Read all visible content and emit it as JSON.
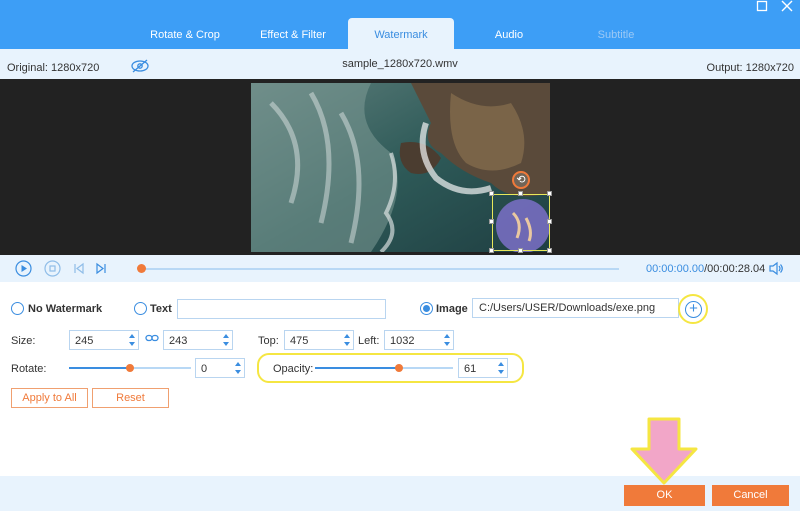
{
  "tabs": [
    {
      "label": "Rotate & Crop"
    },
    {
      "label": "Effect & Filter"
    },
    {
      "label": "Watermark"
    },
    {
      "label": "Audio"
    },
    {
      "label": "Subtitle"
    }
  ],
  "window": {
    "maximize_icon": "maximize-icon",
    "close_icon": "close-icon"
  },
  "info": {
    "original": "Original: 1280x720",
    "filename": "sample_1280x720.wmv",
    "output": "Output: 1280x720"
  },
  "playback": {
    "current_time": "00:00:00.00",
    "total_time": "/00:00:28.04"
  },
  "watermark": {
    "no_watermark_label": "No Watermark",
    "text_label": "Text",
    "text_value": "",
    "image_label": "Image",
    "image_path": "C:/Users/USER/Downloads/exe.png",
    "selected": "image"
  },
  "size": {
    "label": "Size:",
    "width": "245",
    "height": "243"
  },
  "position": {
    "top_label": "Top:",
    "top": "475",
    "left_label": "Left:",
    "left": "1032"
  },
  "rotate": {
    "label": "Rotate:",
    "value": "0",
    "slider_level": 0.5
  },
  "opacity": {
    "label": "Opacity:",
    "value": "61",
    "slider_level": 0.61
  },
  "actions": {
    "apply_all": "Apply to All",
    "reset": "Reset"
  },
  "footer": {
    "ok": "OK",
    "cancel": "Cancel"
  },
  "colors": {
    "accent": "#3d9ef6",
    "orange": "#f07a3a",
    "highlight": "#f5e642",
    "arrow": "#f2a6c8"
  }
}
